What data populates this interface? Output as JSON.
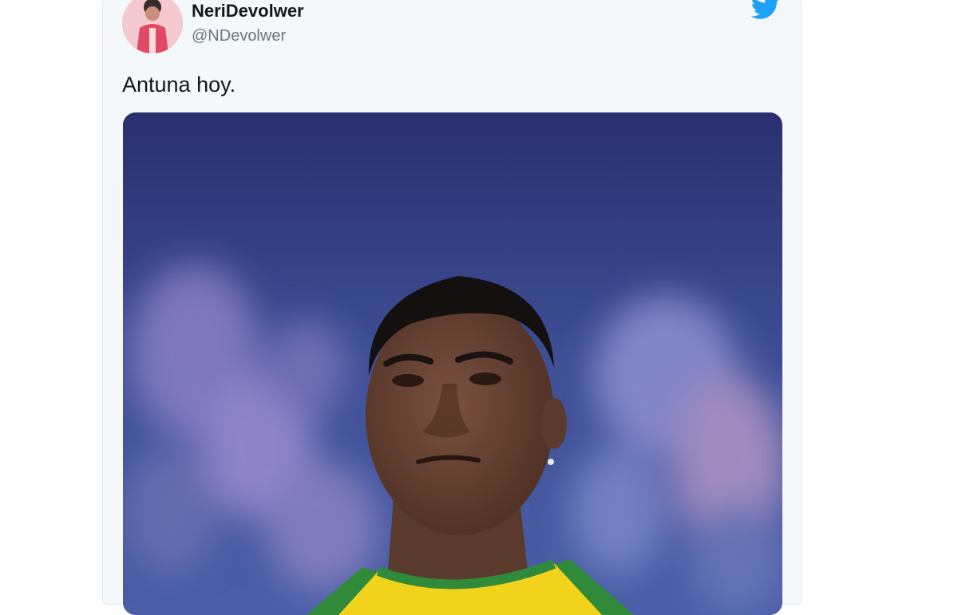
{
  "tweet": {
    "display_name": "NeriDevolwer",
    "handle": "@NDevolwer",
    "text": "Antuna hoy."
  },
  "icons": {
    "brand": "twitter-bird-icon"
  },
  "colors": {
    "twitter_blue": "#1da1f2",
    "card_background": "#f5f8fa",
    "handle_gray": "#657786"
  }
}
